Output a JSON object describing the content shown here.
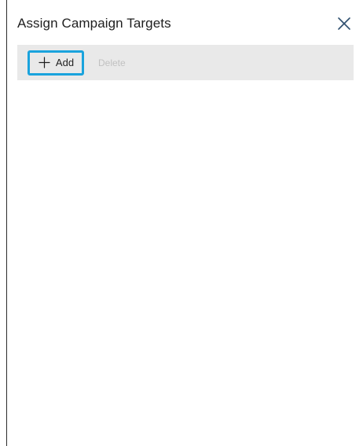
{
  "dialog": {
    "title": "Assign Campaign Targets",
    "close_icon": "close-icon"
  },
  "toolbar": {
    "add_label": "Add",
    "add_icon": "plus-icon",
    "delete_label": "Delete",
    "delete_disabled": true
  },
  "colors": {
    "toolbar_bg": "#e9e9e9",
    "focus_outline": "#1aa3dd",
    "disabled_text": "#c1c1c1",
    "close_icon": "#2f4f6f"
  }
}
